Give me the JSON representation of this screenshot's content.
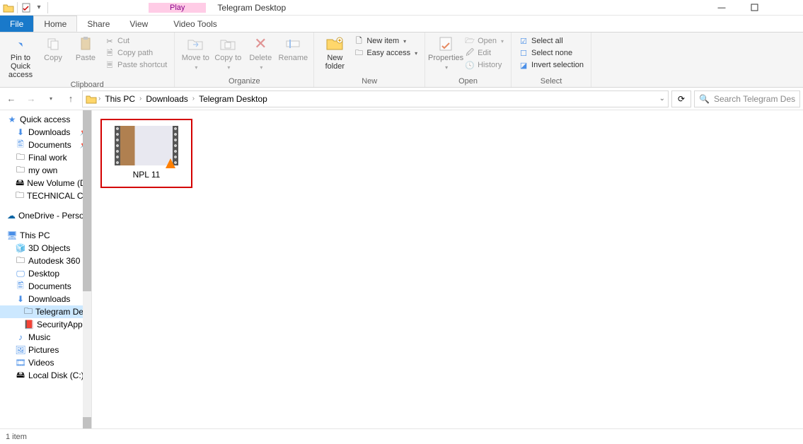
{
  "contextual_tab": "Play",
  "window_title": "Telegram Desktop",
  "tabs": {
    "file": "File",
    "home": "Home",
    "share": "Share",
    "view": "View",
    "video_tools": "Video Tools"
  },
  "ribbon": {
    "clipboard": {
      "pin": "Pin to Quick access",
      "copy": "Copy",
      "paste": "Paste",
      "cut": "Cut",
      "copy_path": "Copy path",
      "paste_shortcut": "Paste shortcut",
      "label": "Clipboard"
    },
    "organize": {
      "move_to": "Move to",
      "copy_to": "Copy to",
      "delete": "Delete",
      "rename": "Rename",
      "label": "Organize"
    },
    "new": {
      "new_folder": "New folder",
      "new_item": "New item",
      "easy_access": "Easy access",
      "label": "New"
    },
    "open": {
      "properties": "Properties",
      "open": "Open",
      "edit": "Edit",
      "history": "History",
      "label": "Open"
    },
    "select": {
      "select_all": "Select all",
      "select_none": "Select none",
      "invert": "Invert selection",
      "label": "Select"
    }
  },
  "breadcrumb": [
    "This PC",
    "Downloads",
    "Telegram Desktop"
  ],
  "search_placeholder": "Search Telegram Desktop",
  "sidebar": {
    "quick_access": "Quick access",
    "qa_items": [
      "Downloads",
      "Documents",
      "Final work",
      "my own",
      "New Volume (D:",
      "TECHNICAL CO"
    ],
    "onedrive": "OneDrive - Person",
    "this_pc": "This PC",
    "pc_items": [
      "3D Objects",
      "Autodesk 360",
      "Desktop",
      "Documents",
      "Downloads",
      "Telegram Deskt",
      "SecurityApplian",
      "Music",
      "Pictures",
      "Videos",
      "Local Disk (C:)"
    ]
  },
  "file": {
    "name": "NPL 11"
  },
  "status": "1 item"
}
